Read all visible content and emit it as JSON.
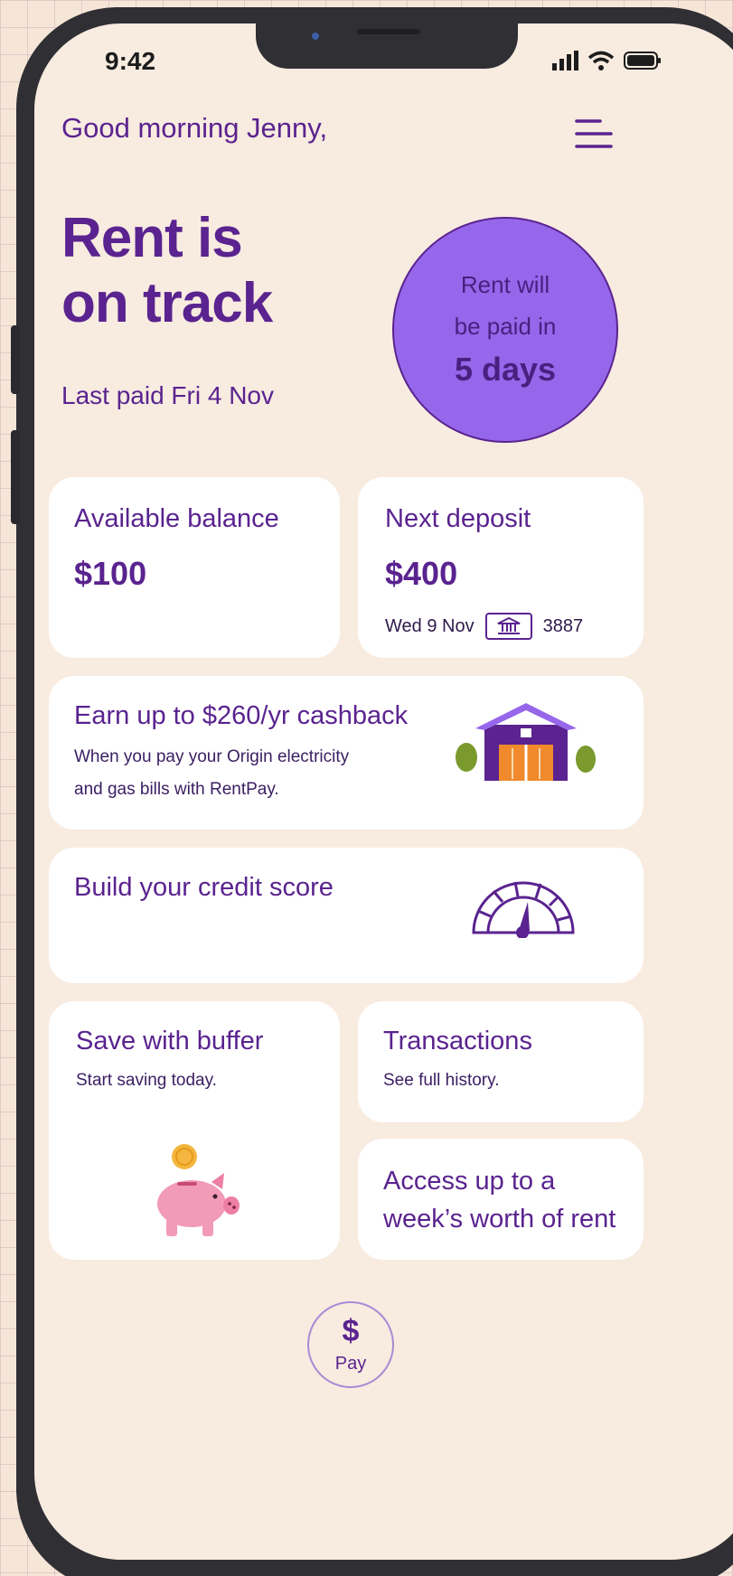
{
  "status_bar": {
    "time": "9:42"
  },
  "header": {
    "greeting": "Good morning Jenny,"
  },
  "hero": {
    "headline_line1": "Rent is",
    "headline_line2": "on track",
    "last_paid": "Last paid Fri 4 Nov"
  },
  "countdown": {
    "line1": "Rent will",
    "line2": "be paid in",
    "days": "5 days"
  },
  "balance_card": {
    "title": "Available balance",
    "amount": "$100"
  },
  "deposit_card": {
    "title": "Next deposit",
    "amount": "$400",
    "date": "Wed 9 Nov",
    "account": "3887"
  },
  "cashback_card": {
    "title": "Earn up to $260/yr cashback",
    "line1": "When you pay your Origin electricity",
    "line2": "and gas bills with RentPay."
  },
  "credit_card": {
    "title": "Build your credit score"
  },
  "buffer_card": {
    "title": "Save with buffer",
    "subtitle": "Start saving today."
  },
  "transactions_card": {
    "title": "Transactions",
    "subtitle": "See full history."
  },
  "access_card": {
    "line1": "Access up to a",
    "line2": "week’s worth of rent"
  },
  "pay_button": {
    "icon": "$",
    "label": "Pay"
  },
  "colors": {
    "brand_purple": "#5a238f",
    "circle_purple": "#9667ea",
    "background": "#f8ebe0",
    "card": "#ffffff",
    "house_orange": "#f08a2c",
    "leaf_green": "#7a9a2e",
    "pig_pink": "#f29bb8",
    "coin_gold": "#f4b63e"
  },
  "icons": [
    "menu-icon",
    "bank-icon",
    "house-icon",
    "gauge-icon",
    "piggy-bank-icon",
    "signal-icon",
    "wifi-icon",
    "battery-icon"
  ]
}
